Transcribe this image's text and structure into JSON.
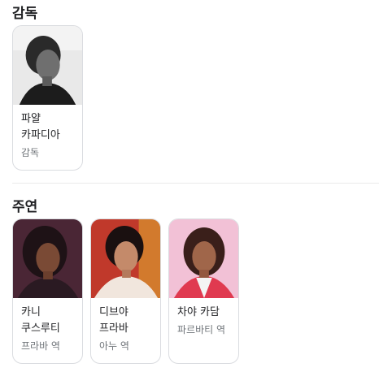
{
  "director_section": {
    "title": "감독",
    "people": [
      {
        "name": "파얄 카파디아",
        "role": "감독",
        "photo_icon": "portrait-photo-bw"
      }
    ]
  },
  "cast_section": {
    "title": "주연",
    "people": [
      {
        "name": "카니 쿠스루티",
        "role": "프라바 역",
        "photo_icon": "portrait-photo"
      },
      {
        "name": "디브야 프라바",
        "role": "아누 역",
        "photo_icon": "portrait-photo"
      },
      {
        "name": "차야 카담",
        "role": "파르바티 역",
        "photo_icon": "portrait-photo"
      }
    ]
  },
  "colors": {
    "divider": "#ebebeb",
    "card_border": "#dadce0",
    "role_text": "#70757a",
    "name_text": "#202124"
  }
}
